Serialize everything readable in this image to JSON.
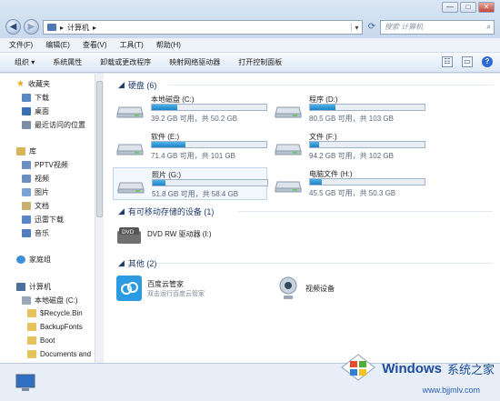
{
  "window": {
    "buttons": [
      "—",
      "□",
      "✕"
    ],
    "address": {
      "path_root": "▸",
      "path_item": "计算机",
      "path_sep": "▸"
    },
    "search_placeholder": "搜索 计算机"
  },
  "menu": [
    "文件(F)",
    "编辑(E)",
    "查看(V)",
    "工具(T)",
    "帮助(H)"
  ],
  "toolbar": [
    "组织 ▾",
    "系统属性",
    "卸载或更改程序",
    "映射网络驱动器",
    "打开控制面板"
  ],
  "sidebar": {
    "favorites_label": "收藏夹",
    "favorites": [
      "下载",
      "桌面",
      "最近访问的位置"
    ],
    "library_label": "库",
    "libraries": [
      "PPTV视频",
      "视频",
      "图片",
      "文档",
      "迅雷下载",
      "音乐"
    ],
    "homegroup_label": "家庭组",
    "computer_label": "计算机",
    "drive_c": "本地磁盘 (C:)",
    "folders": [
      "$Recycle.Bin",
      "BackupFonts",
      "Boot",
      "Documents and"
    ]
  },
  "groups": {
    "hdd": "硬盘 (6)",
    "removable": "有可移动存储的设备 (1)",
    "other": "其他 (2)"
  },
  "drives": [
    {
      "name": "本地磁盘 (C:)",
      "info": "39.2 GB 可用，共 50.2 GB",
      "used_fraction": 0.22
    },
    {
      "name": "程序 (D:)",
      "info": "80.5 GB 可用，共 103 GB",
      "used_fraction": 0.22
    },
    {
      "name": "软件 (E:)",
      "info": "71.4 GB 可用，共 101 GB",
      "used_fraction": 0.29
    },
    {
      "name": "文件 (F:)",
      "info": "94.2 GB 可用，共 102 GB",
      "used_fraction": 0.08
    },
    {
      "name": "照片 (G:)",
      "info": "51.8 GB 可用，共 58.4 GB",
      "used_fraction": 0.11
    },
    {
      "name": "电脑文件 (H:)",
      "info": "45.5 GB 可用，共 50.3 GB",
      "used_fraction": 0.1
    }
  ],
  "dvd": "DVD RW 驱动器 (I:)",
  "other_items": [
    {
      "name": "百度云管家",
      "sub": "双击运行百度云管家"
    },
    {
      "name": "视频设备"
    }
  ],
  "watermark": {
    "brand": "Windows",
    "suffix": "系统之家",
    "url": "www.bjjmlv.com"
  },
  "colors": {
    "accent": "#1f82c6",
    "group_title": "#1e3b6d"
  }
}
